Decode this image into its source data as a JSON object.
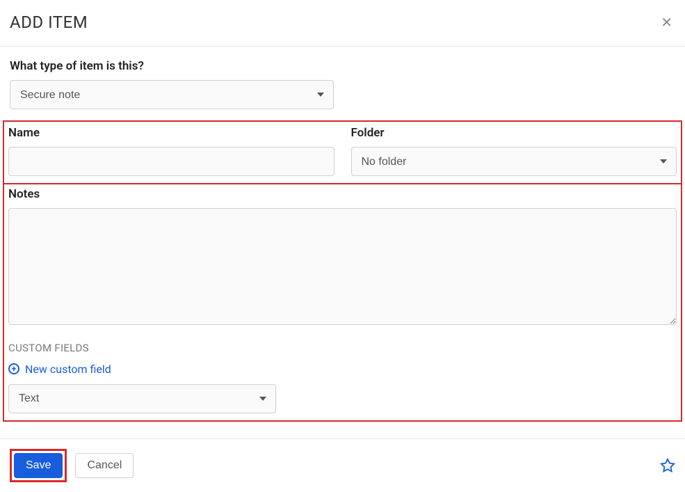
{
  "header": {
    "title": "ADD ITEM",
    "close_symbol": "✕"
  },
  "typeSection": {
    "label": "What type of item is this?",
    "selected": "Secure note"
  },
  "nameFolder": {
    "name_label": "Name",
    "name_value": "",
    "folder_label": "Folder",
    "folder_selected": "No folder"
  },
  "notes": {
    "label": "Notes",
    "value": ""
  },
  "customFields": {
    "heading": "CUSTOM FIELDS",
    "new_link": "New custom field",
    "type_selected": "Text"
  },
  "footer": {
    "save_label": "Save",
    "cancel_label": "Cancel"
  }
}
